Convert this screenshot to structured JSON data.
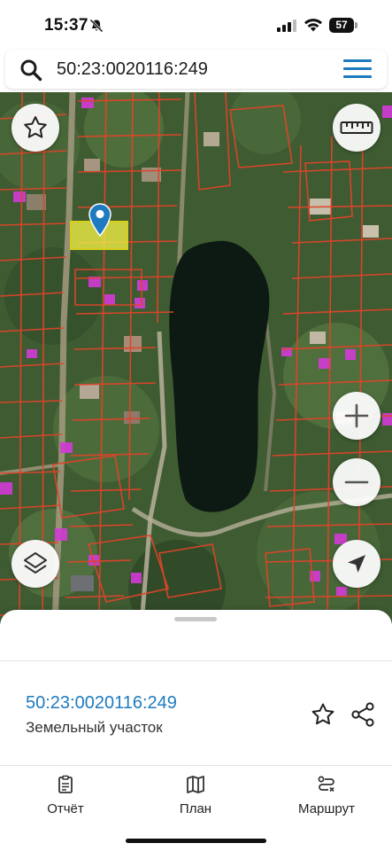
{
  "status_bar": {
    "time": "15:37",
    "battery": "57",
    "icons": [
      "bell-off-icon",
      "signal-icon",
      "wifi-icon",
      "battery-icon"
    ]
  },
  "search": {
    "value": "50:23:0020116:249",
    "icon": "search-icon",
    "menu_icon": "hamburger-menu-icon"
  },
  "map": {
    "buttons": [
      "favorite-star-icon",
      "ruler-icon",
      "zoom-in-icon",
      "zoom-out-icon",
      "layers-icon",
      "navigate-arrow-icon"
    ],
    "colors": {
      "parcel_border": "#e0442a",
      "selected_parcel_fill": "#f2f047",
      "selected_parcel_border": "#c9c21a",
      "marker": "#1e7bc0",
      "building_highlight": "#d23ad6",
      "pond": "#0d1a13"
    }
  },
  "sheet": {
    "parcel_id": "50:23:0020116:249",
    "parcel_type": "Земельный участок",
    "actions": [
      "star-icon",
      "share-icon"
    ]
  },
  "tabs": [
    {
      "label": "Отчёт",
      "icon": "report-icon"
    },
    {
      "label": "План",
      "icon": "map-plan-icon"
    },
    {
      "label": "Маршрут",
      "icon": "route-icon"
    }
  ]
}
